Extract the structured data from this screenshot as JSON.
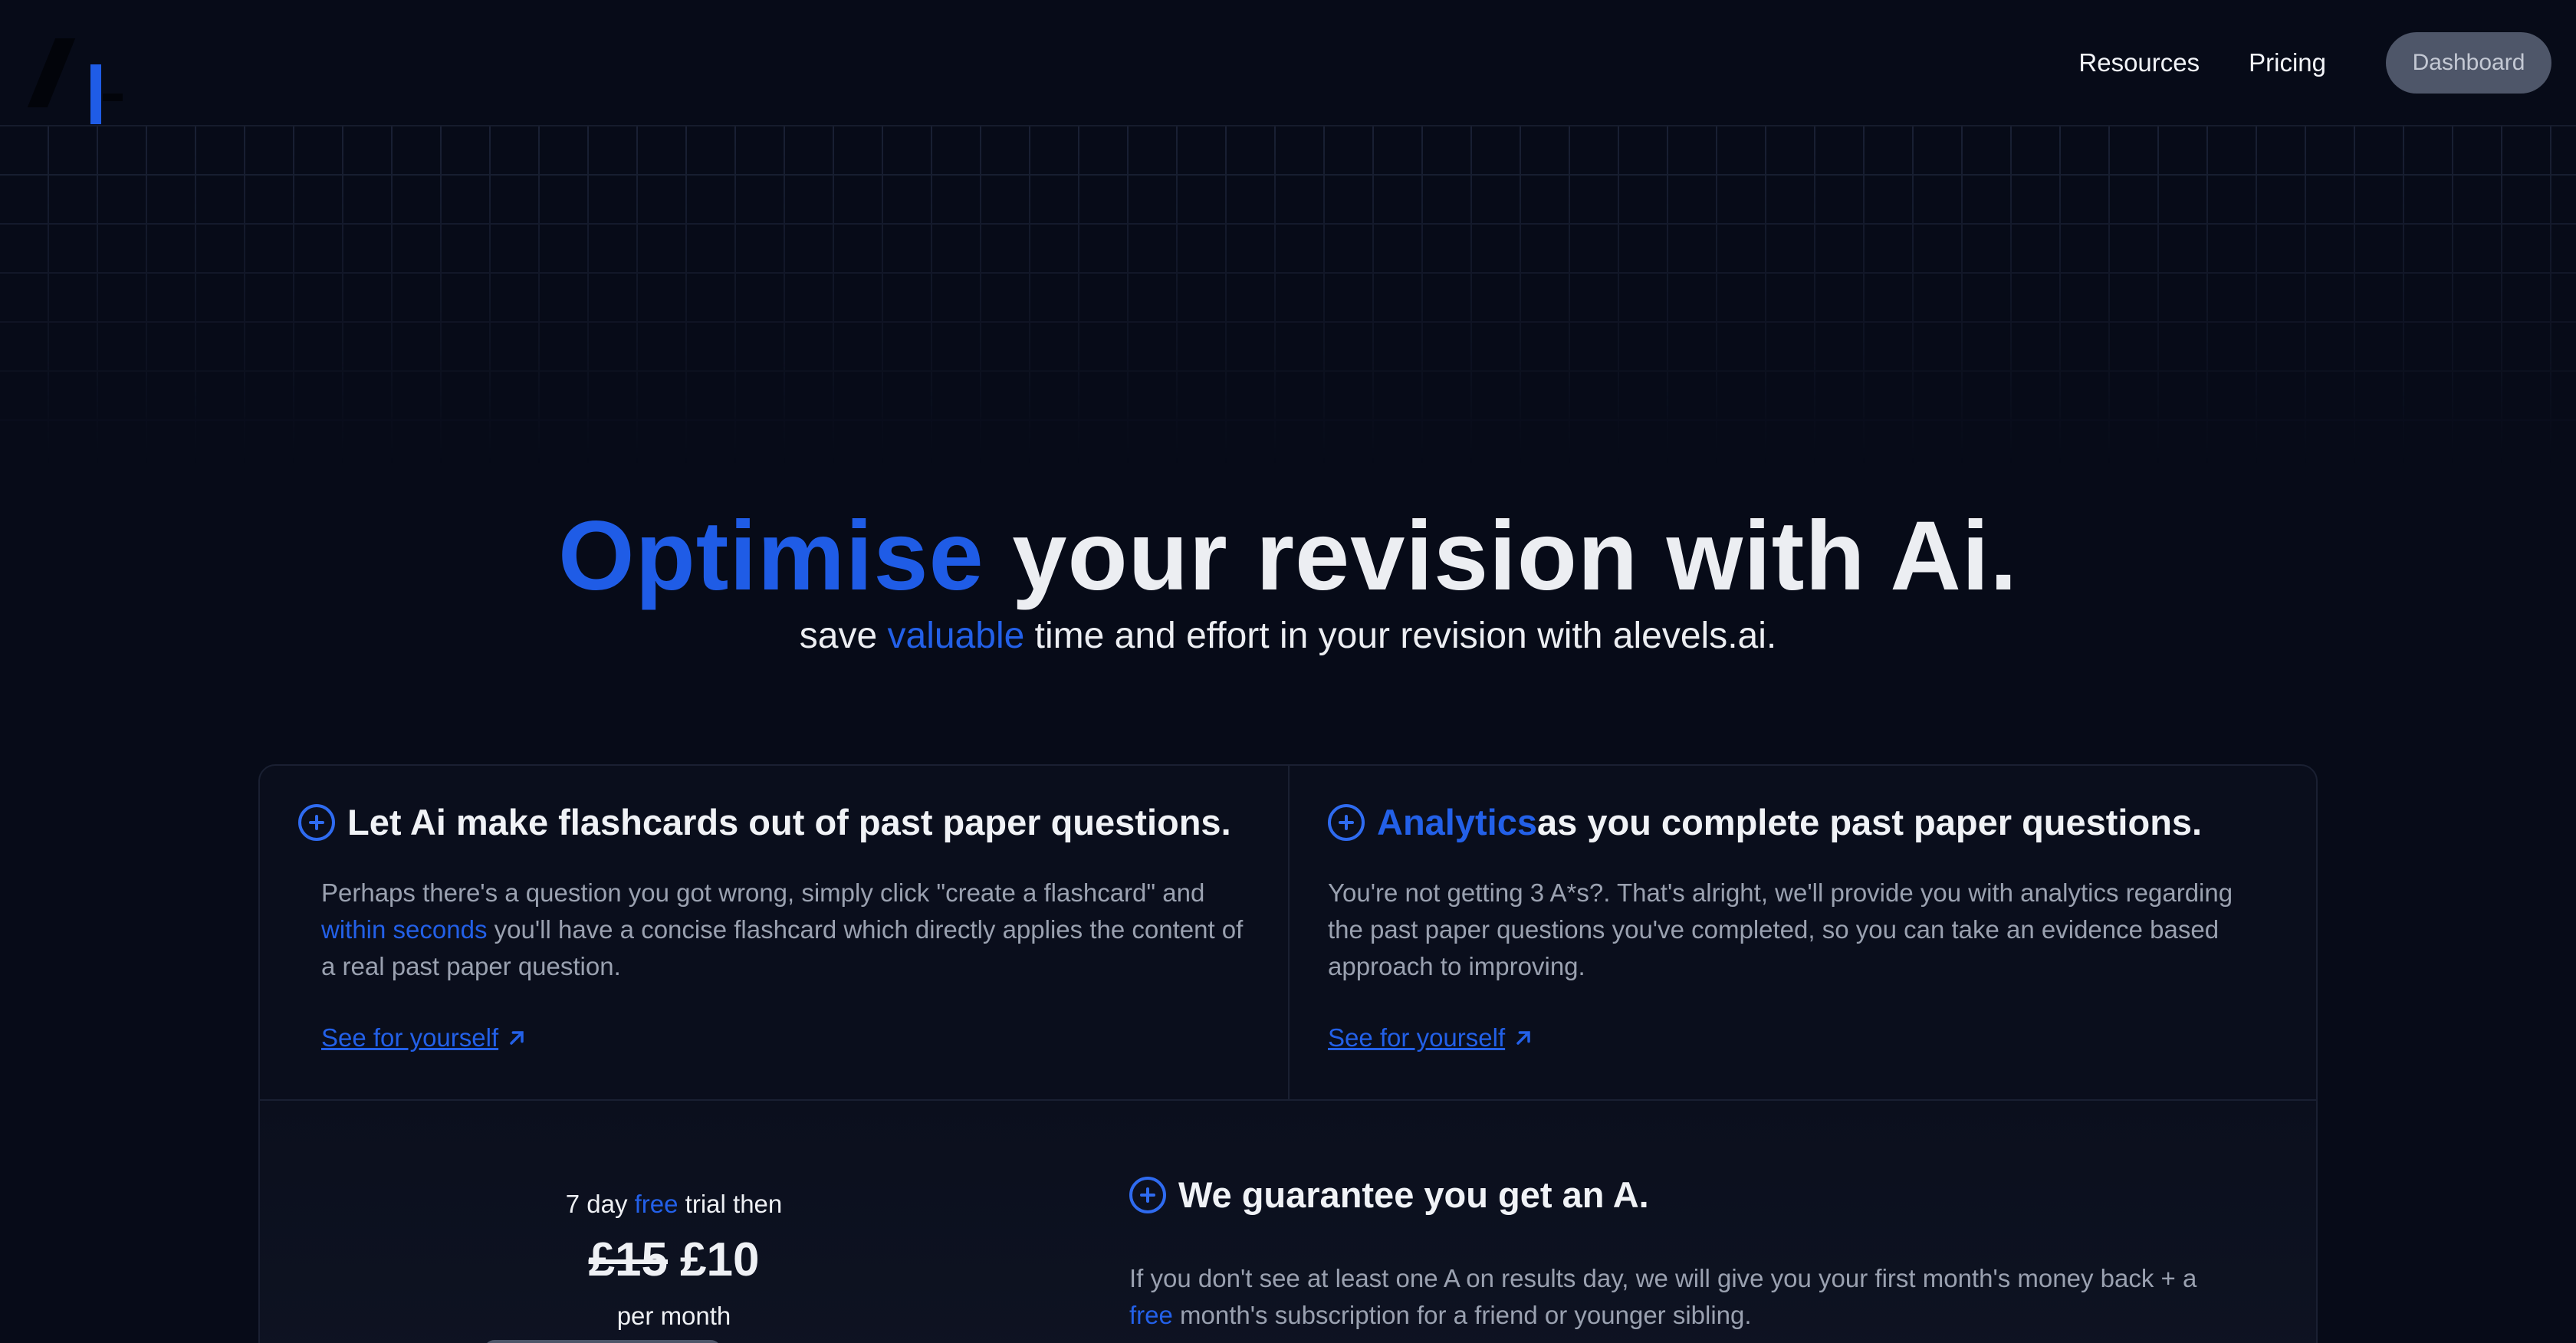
{
  "nav": {
    "links": [
      "Resources",
      "Pricing"
    ],
    "dashboard_label": "Dashboard"
  },
  "hero": {
    "title_accent": "Optimise",
    "title_rest": " your revision with Ai.",
    "sub_before": "save ",
    "sub_accent": "valuable",
    "sub_after": " time and effort in your revision with alevels.ai."
  },
  "features": [
    {
      "title_accent": "",
      "title_rest": "Let Ai make flashcards out of past paper questions.",
      "body_before": "Perhaps there's a question you got wrong, simply click \"create a flashcard\" and ",
      "body_accent": "within seconds",
      "body_after": " you'll have a concise flashcard which directly applies the content of a real past paper question.",
      "link": "See for yourself"
    },
    {
      "title_accent": "Analytics",
      "title_rest": " as you complete past paper questions.",
      "body_before": "You're not getting 3 A*s?. That's alright, we'll provide you with analytics regarding the past paper questions you've completed, so you can take an evidence based approach to improving.",
      "body_accent": "",
      "body_after": "",
      "link": "See for yourself"
    }
  ],
  "pricing": {
    "trial_before": "7 day ",
    "trial_accent": "free",
    "trial_after": " trial then",
    "old_price": "£15",
    "new_price": "£10",
    "period": "per month"
  },
  "guarantee": {
    "title": "We guarantee you get an A.",
    "body_before": "If you don't see at least one A on results day, we will give you your first month's money back + a ",
    "body_accent": "free",
    "body_after": " month's subscription for a friend or younger sibling."
  },
  "colors": {
    "background": "#070b18",
    "accent": "#1f5ce6",
    "button": "#4e5669"
  }
}
